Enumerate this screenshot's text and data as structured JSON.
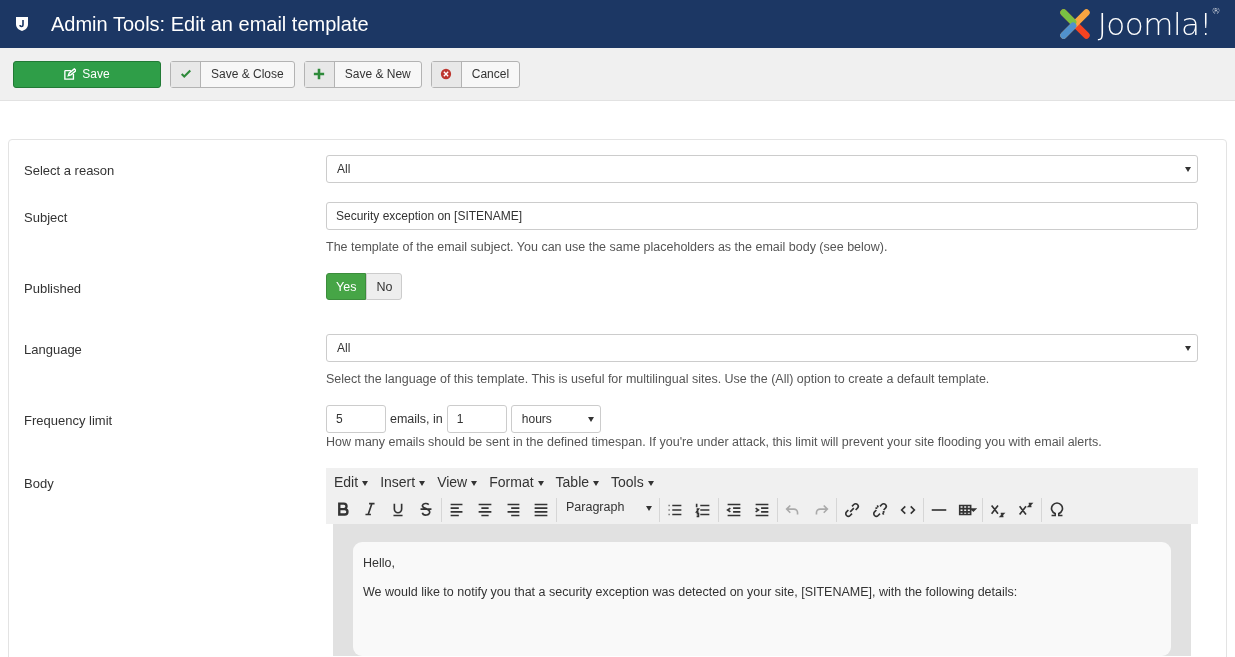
{
  "header": {
    "title": "Admin Tools: Edit an email template",
    "logo_text": "Joomla!$^{®}$"
  },
  "toolbar": [
    {
      "kind": "save",
      "label": "Save"
    },
    {
      "kind": "check",
      "label": "Save & Close"
    },
    {
      "kind": "plus",
      "label": "Save & New"
    },
    {
      "kind": "cancel",
      "label": "Cancel"
    }
  ],
  "form": {
    "reason": {
      "label": "Select a reason",
      "value": "All"
    },
    "subject": {
      "label": "Subject",
      "value": "Security exception on [SITENAME]",
      "help": "The template of the email subject. You can use the same placeholders as the email body (see below)."
    },
    "published": {
      "label": "Published",
      "options": [
        {
          "label": "Yes",
          "selected": true
        },
        {
          "label": "No",
          "selected": false
        }
      ]
    },
    "language": {
      "label": "Language",
      "value": "All",
      "help": "Select the language of this template. This is useful for multilingual sites. Use the (All) option to create a default template."
    },
    "frequency": {
      "label": "Frequency limit",
      "count": "5",
      "middle": "emails, in",
      "amount": "1",
      "unit": "hours",
      "help": "How many emails should be sent in the defined timespan. If you're under attack, this limit will prevent your site flooding you with email alerts."
    },
    "body": {
      "label": "Body",
      "menus": [
        "Edit",
        "Insert",
        "View",
        "Format",
        "Table",
        "Tools"
      ],
      "format_value": "Paragraph",
      "tools": [
        {
          "kind": "bold",
          "disabled": false
        },
        {
          "kind": "italic",
          "disabled": false
        },
        {
          "kind": "underline",
          "disabled": false
        },
        {
          "kind": "strike",
          "disabled": false
        },
        {
          "kind": "sep"
        },
        {
          "kind": "align-left",
          "disabled": false
        },
        {
          "kind": "align-center",
          "disabled": false
        },
        {
          "kind": "align-right",
          "disabled": false
        },
        {
          "kind": "justify",
          "disabled": false
        },
        {
          "kind": "sep"
        },
        {
          "kind": "format"
        },
        {
          "kind": "sep"
        },
        {
          "kind": "bullets",
          "disabled": false
        },
        {
          "kind": "numbers",
          "disabled": false
        },
        {
          "kind": "sep"
        },
        {
          "kind": "outdent",
          "disabled": false
        },
        {
          "kind": "indent",
          "disabled": false
        },
        {
          "kind": "sep"
        },
        {
          "kind": "undo",
          "disabled": true
        },
        {
          "kind": "redo",
          "disabled": true
        },
        {
          "kind": "sep"
        },
        {
          "kind": "link",
          "disabled": false
        },
        {
          "kind": "unlink",
          "disabled": false
        },
        {
          "kind": "code",
          "disabled": false
        },
        {
          "kind": "sep"
        },
        {
          "kind": "hr",
          "disabled": false
        },
        {
          "kind": "table",
          "disabled": false
        },
        {
          "kind": "sep"
        },
        {
          "kind": "subscript",
          "disabled": false
        },
        {
          "kind": "superscript",
          "disabled": false
        },
        {
          "kind": "sep"
        },
        {
          "kind": "omega",
          "disabled": false
        }
      ],
      "paragraphs": [
        "Hello,",
        "We would like to notify you that a security exception was detected on your site, [SITENAME], with the following details:"
      ]
    }
  }
}
